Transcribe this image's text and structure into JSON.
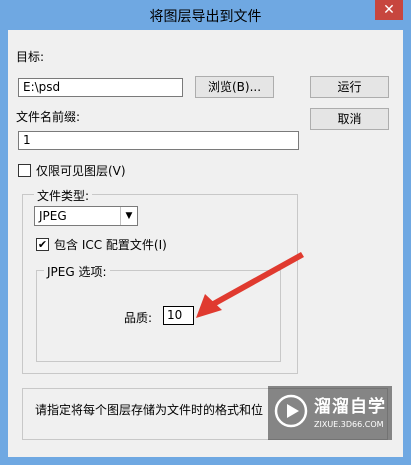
{
  "window": {
    "title": "将图层导出到文件",
    "close_glyph": "✕"
  },
  "target": {
    "label": "目标:",
    "path_value": "E:\\psd",
    "browse_label": "浏览(B)..."
  },
  "prefix": {
    "label": "文件名前缀:",
    "value": "1"
  },
  "actions": {
    "run_label": "运行",
    "cancel_label": "取消"
  },
  "visible_only": {
    "label": "仅限可见图层(V)",
    "checked": false
  },
  "file_type": {
    "group_label": "文件类型:",
    "selected": "JPEG",
    "arrow_glyph": "▼"
  },
  "icc": {
    "label": "包含 ICC 配置文件(I)",
    "checked": true,
    "check_glyph": "✔"
  },
  "jpeg_options": {
    "group_label": "JPEG 选项:",
    "quality_label": "品质:",
    "quality_value": "10"
  },
  "status": {
    "text": "请指定将每个图层存储为文件时的格式和位"
  },
  "watermark": {
    "brand": "溜溜自学",
    "url": "ZIXUE.3D66.COM"
  },
  "colors": {
    "titlebar": "#6fa8e2",
    "close": "#c7463e",
    "arrow": "#e03a2f"
  }
}
